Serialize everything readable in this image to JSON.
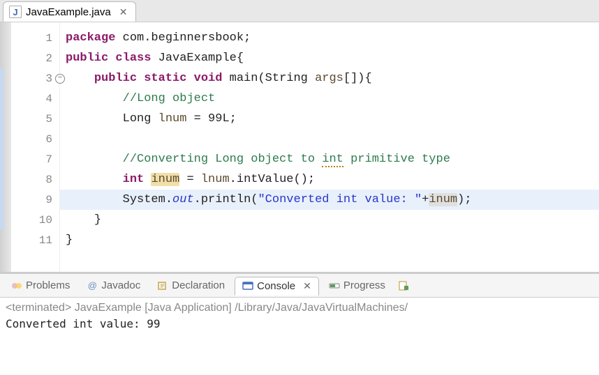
{
  "editorTab": {
    "filename": "JavaExample.java",
    "iconLetter": "J"
  },
  "code": {
    "lines": [
      {
        "n": 1,
        "tokens": [
          [
            "k-purple",
            "package"
          ],
          [
            "text",
            " com.beginnersbook;"
          ]
        ]
      },
      {
        "n": 2,
        "tokens": [
          [
            "k-purple",
            "public class"
          ],
          [
            "text",
            " JavaExample{"
          ]
        ]
      },
      {
        "n": 3,
        "fold": true,
        "indent": 1,
        "tokens": [
          [
            "k-purple",
            "public static"
          ],
          [
            "text",
            " "
          ],
          [
            "k-purple",
            "void"
          ],
          [
            "text",
            " main(String "
          ],
          [
            "k-brown",
            "args"
          ],
          [
            "text",
            "[]){"
          ]
        ]
      },
      {
        "n": 4,
        "indent": 2,
        "tokens": [
          [
            "comment",
            "//Long object"
          ]
        ]
      },
      {
        "n": 5,
        "indent": 2,
        "tokens": [
          [
            "text",
            "Long "
          ],
          [
            "k-brown",
            "lnum"
          ],
          [
            "text",
            " = 99L;"
          ]
        ]
      },
      {
        "n": 6,
        "indent": 2,
        "tokens": []
      },
      {
        "n": 7,
        "indent": 2,
        "tokens": [
          [
            "comment",
            "//Converting Long object to "
          ],
          [
            "comment squiggle",
            "int"
          ],
          [
            "comment",
            " primitive type"
          ]
        ]
      },
      {
        "n": 8,
        "indent": 2,
        "tokens": [
          [
            "k-purple",
            "int"
          ],
          [
            "text",
            " "
          ],
          [
            "k-brown var-highlight",
            "inum"
          ],
          [
            "text",
            " = "
          ],
          [
            "k-brown",
            "lnum"
          ],
          [
            "text",
            ".intValue();"
          ]
        ]
      },
      {
        "n": 9,
        "highlight": true,
        "indent": 2,
        "tokens": [
          [
            "text",
            "System."
          ],
          [
            "static-field",
            "out"
          ],
          [
            "text",
            ".println("
          ],
          [
            "string",
            "\"Converted int value: \""
          ],
          [
            "text",
            "+"
          ],
          [
            "k-brown var-highlight-gray",
            "inum"
          ],
          [
            "text",
            ");"
          ]
        ]
      },
      {
        "n": 10,
        "indent": 1,
        "tokens": [
          [
            "text",
            "}"
          ]
        ]
      },
      {
        "n": 11,
        "tokens": [
          [
            "text",
            "}"
          ]
        ]
      }
    ]
  },
  "bottomTabs": {
    "problems": "Problems",
    "javadoc": "Javadoc",
    "declaration": "Declaration",
    "console": "Console",
    "progress": "Progress"
  },
  "console": {
    "header": "<terminated> JavaExample [Java Application] /Library/Java/JavaVirtualMachines/",
    "output": "Converted int value: 99"
  }
}
